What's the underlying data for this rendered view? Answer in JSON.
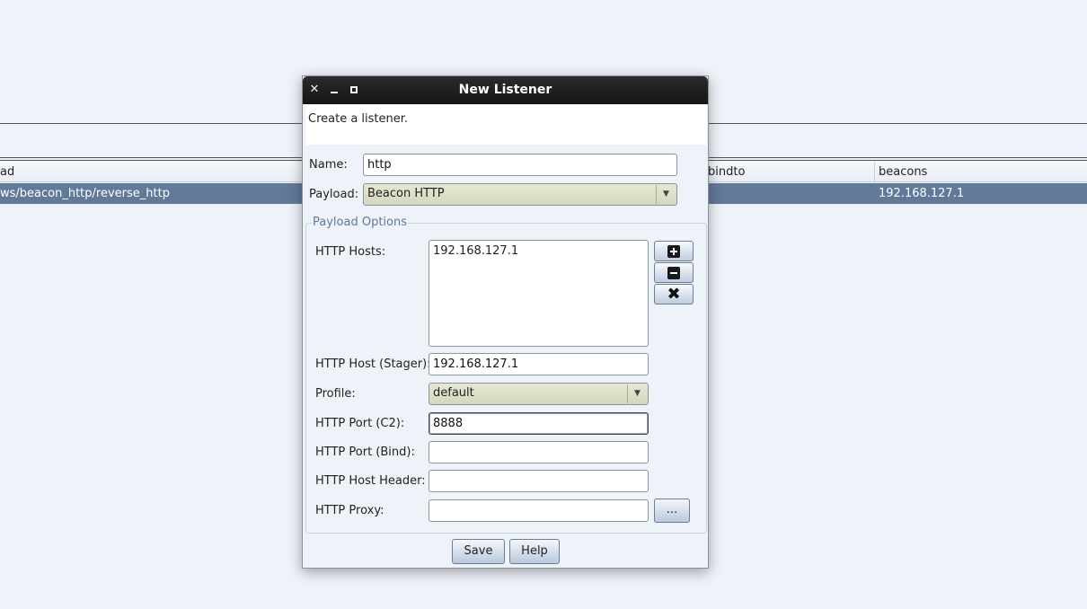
{
  "background": {
    "table_header": {
      "col_payload": "ad",
      "col_bindto": "bindto",
      "col_beacons": "beacons"
    },
    "row": {
      "payload": "ws/beacon_http/reverse_http",
      "beacons": "192.168.127.1"
    },
    "selected_row_color": "#627a9a"
  },
  "dialog": {
    "title": "New Listener",
    "description": "Create a listener.",
    "name_label": "Name:",
    "name_value": "http",
    "payload_label": "Payload:",
    "payload_value": "Beacon HTTP",
    "options_title": "Payload Options",
    "http_hosts_label": "HTTP Hosts:",
    "http_hosts": [
      "192.168.127.1"
    ],
    "stager_label": "HTTP Host (Stager):",
    "stager_value": "192.168.127.1",
    "profile_label": "Profile:",
    "profile_value": "default",
    "port_c2_label": "HTTP Port (C2):",
    "port_c2_value": "8888",
    "port_bind_label": "HTTP Port (Bind):",
    "port_bind_value": "",
    "host_header_label": "HTTP Host Header:",
    "host_header_value": "",
    "proxy_label": "HTTP Proxy:",
    "proxy_value": "",
    "proxy_button": "...",
    "save_button": "Save",
    "help_button": "Help",
    "icons": {
      "close": "close-icon",
      "minimize": "minimize-icon",
      "maximize": "maximize-icon",
      "add": "plus-icon",
      "remove": "minus-icon",
      "clear": "x-icon"
    }
  }
}
